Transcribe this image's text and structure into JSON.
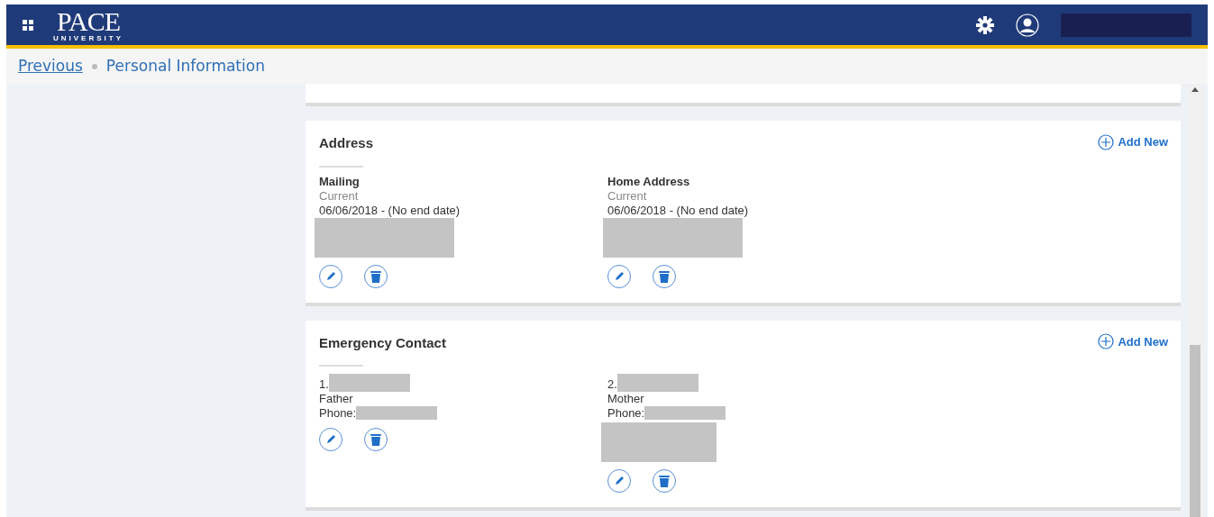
{
  "header": {
    "logo_main": "PACE",
    "logo_sub": "UNIVERSITY"
  },
  "breadcrumb": {
    "previous": "Previous",
    "current": "Personal Information"
  },
  "sections": [
    {
      "title": "Address",
      "add_label": "Add New",
      "entries": [
        {
          "kind": "address",
          "title": "Mailing",
          "status": "Current",
          "dates": "06/06/2018 - (No end date)"
        },
        {
          "kind": "address",
          "title": "Home Address",
          "status": "Current",
          "dates": "06/06/2018 - (No end date)"
        }
      ]
    },
    {
      "title": "Emergency Contact",
      "add_label": "Add New",
      "entries": [
        {
          "kind": "contact",
          "number": "1.",
          "relation": "Father",
          "phone_label": "Phone:",
          "has_extra": false
        },
        {
          "kind": "contact",
          "number": "2.",
          "relation": "Mother",
          "phone_label": "Phone:",
          "has_extra": true
        }
      ]
    }
  ]
}
